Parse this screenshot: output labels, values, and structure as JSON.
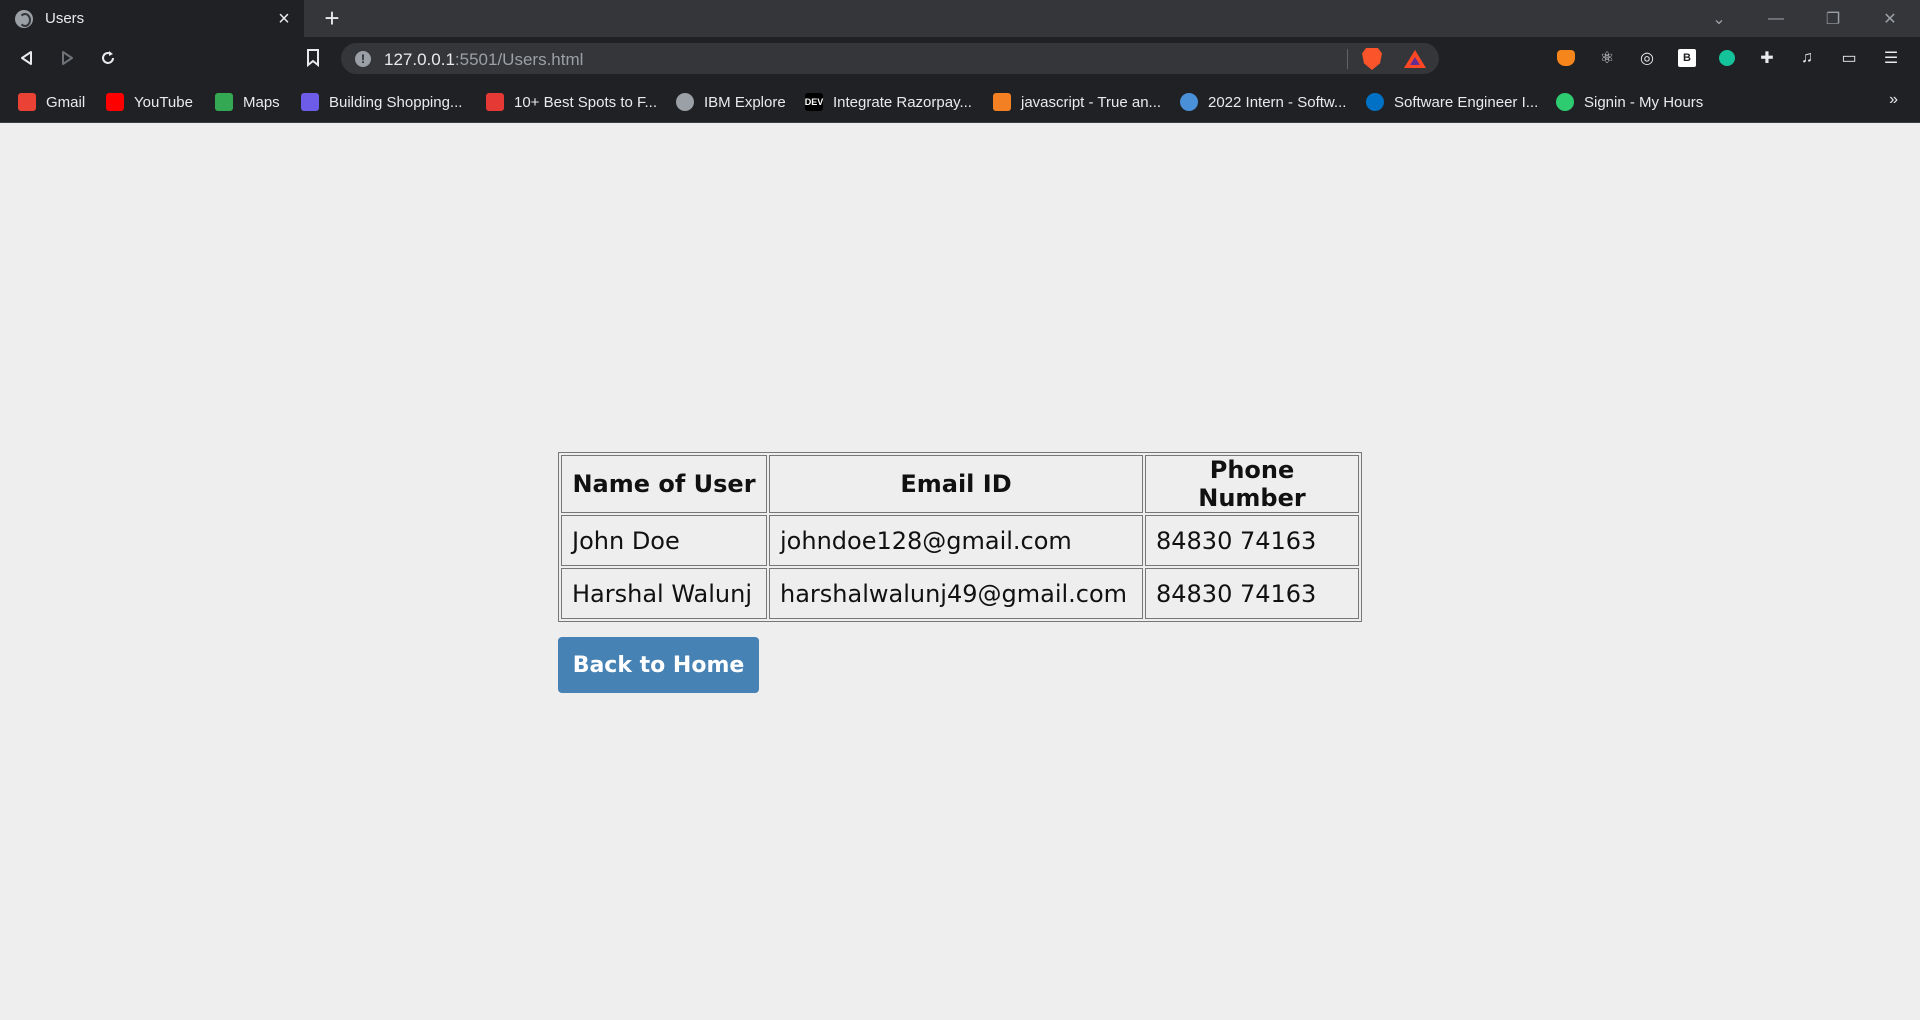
{
  "browser": {
    "tab": {
      "title": "Users"
    },
    "omnibox": {
      "url_host": "127.0.0.1",
      "url_rest": ":5501/Users.html"
    },
    "bookmarks": [
      {
        "label": "Gmail",
        "icon": "gmail-icon",
        "color": "#ea4335"
      },
      {
        "label": "YouTube",
        "icon": "youtube-icon",
        "color": "#ff0000"
      },
      {
        "label": "Maps",
        "icon": "maps-icon",
        "color": "#34a853"
      },
      {
        "label": "Building Shopping...",
        "icon": "wp-icon",
        "color": "#6c5ce7"
      },
      {
        "label": "10+ Best Spots to F...",
        "icon": "spot-icon",
        "color": "#e53935"
      },
      {
        "label": "IBM Explore",
        "icon": "globe-icon",
        "color": "#9aa0a6"
      },
      {
        "label": "Integrate Razorpay...",
        "icon": "dev-icon",
        "color": "#000000",
        "icon_text": "DEV"
      },
      {
        "label": "javascript - True an...",
        "icon": "stackoverflow-icon",
        "color": "#f48024"
      },
      {
        "label": "2022 Intern - Softw...",
        "icon": "intern-icon",
        "color": "#4a90d9"
      },
      {
        "label": "Software Engineer I...",
        "icon": "intel-icon",
        "color": "#0071c5"
      },
      {
        "label": "Signin - My Hours",
        "icon": "myhours-icon",
        "color": "#2ecc71"
      }
    ]
  },
  "users_table": {
    "headers": [
      "Name of User",
      "Email ID",
      "Phone Number"
    ],
    "rows": [
      [
        "John Doe",
        "johndoe128@gmail.com",
        "84830 74163"
      ],
      [
        "Harshal Walunj",
        "harshalwalunj49@gmail.com",
        "84830 74163"
      ]
    ]
  },
  "back_button": {
    "label": "Back to Home",
    "color": "#4682b4"
  }
}
